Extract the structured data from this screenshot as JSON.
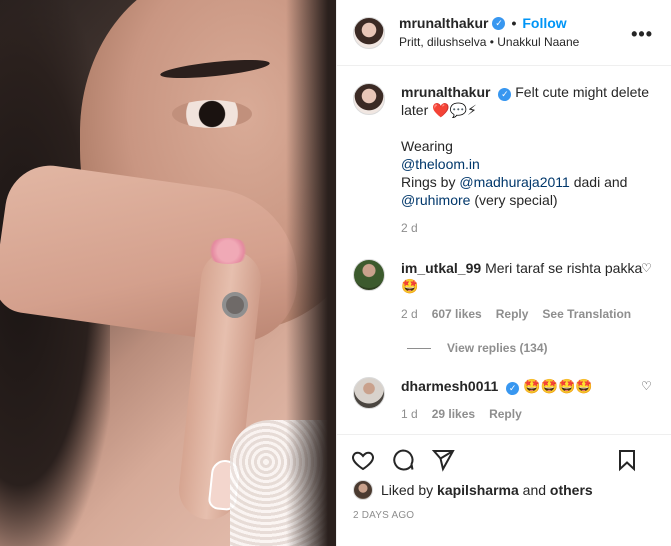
{
  "header": {
    "username": "mrunalthakur",
    "follow_label": "Follow",
    "subtitle_people": "Pritt, dilushselva",
    "subtitle_audio": "Unakkul Naane",
    "more_label": "•••"
  },
  "caption": {
    "username": "mrunalthakur",
    "text": "Felt cute might delete later",
    "emojis": "❤️💬⚡",
    "wearing_label": "Wearing",
    "brand_tag": "@theloom.in",
    "rings_prefix": "Rings by",
    "rings_tag": "@madhuraja2011",
    "rings_suffix": "dadi and",
    "ruhi_tag": "@ruhimore",
    "ruhi_suffix": "(very special)",
    "time": "2 d"
  },
  "comments": [
    {
      "username": "im_utkal_99",
      "text": "Meri taraf se rishta pakka 🤩",
      "time": "2 d",
      "likes": "607 likes",
      "reply": "Reply",
      "translate": "See Translation",
      "view_replies": "View replies (134)"
    },
    {
      "username": "dharmesh0011",
      "text": "🤩🤩🤩🤩",
      "time": "1 d",
      "likes": "29 likes",
      "reply": "Reply"
    }
  ],
  "likes": {
    "prefix": "Liked by",
    "user": "kapilsharma",
    "and": "and",
    "others": "others"
  },
  "timestamp": "2 DAYS AGO",
  "colors": {
    "accent": "#0095f6",
    "verified": "#3897f0",
    "text": "#262626",
    "muted": "#8e8e8e"
  }
}
